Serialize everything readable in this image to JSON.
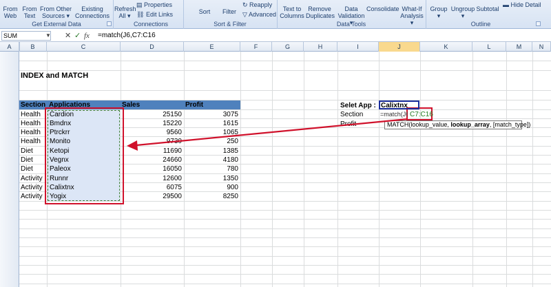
{
  "ribbon": {
    "buttons": [
      {
        "line1": "From",
        "line2": "Web"
      },
      {
        "line1": "From",
        "line2": "Text"
      },
      {
        "line1": "From Other",
        "line2": "Sources ▾"
      },
      {
        "line1": "Existing",
        "line2": "Connections"
      },
      {
        "line1": "Refresh",
        "line2": "All ▾"
      },
      {
        "line1": "Properties",
        "line2": ""
      },
      {
        "line1": "Edit Links",
        "line2": ""
      },
      {
        "line1": "Sort",
        "line2": ""
      },
      {
        "line1": "Filter",
        "line2": ""
      },
      {
        "line1": "Reapply",
        "line2": ""
      },
      {
        "line1": "Advanced",
        "line2": ""
      },
      {
        "line1": "Text to",
        "line2": "Columns"
      },
      {
        "line1": "Remove",
        "line2": "Duplicates"
      },
      {
        "line1": "Data",
        "line2": "Validation ▾"
      },
      {
        "line1": "Consolidate",
        "line2": ""
      },
      {
        "line1": "What-If",
        "line2": "Analysis ▾"
      },
      {
        "line1": "Group",
        "line2": "▾"
      },
      {
        "line1": "Ungroup",
        "line2": "▾"
      },
      {
        "line1": "Subtotal",
        "line2": ""
      },
      {
        "line1": "Hide Detail",
        "line2": ""
      }
    ],
    "groups": [
      "Get External Data",
      "Connections",
      "Sort & Filter",
      "Data Tools",
      "Outline"
    ]
  },
  "formula_bar": {
    "name_box": "SUM",
    "cancel_icon": "✕",
    "enter_icon": "✓",
    "fx_icon": "fx",
    "formula": "=match(J6,C7:C16"
  },
  "columns": [
    "A",
    "B",
    "C",
    "D",
    "E",
    "F",
    "G",
    "H",
    "I",
    "J",
    "K",
    "L",
    "M",
    "N"
  ],
  "sheet": {
    "title": "INDEX and MATCH",
    "headers": {
      "section": "Section",
      "applications": "Applications",
      "sales": "Sales",
      "profit": "Profit"
    },
    "rows": [
      {
        "section": "Health",
        "app": "Cardion",
        "sales": "25150",
        "profit": "3075"
      },
      {
        "section": "Health",
        "app": "Bmdnx",
        "sales": "15220",
        "profit": "1615"
      },
      {
        "section": "Health",
        "app": "Ptrckrr",
        "sales": "9560",
        "profit": "1065"
      },
      {
        "section": "Health",
        "app": "Monito",
        "sales": "9730",
        "profit": "250"
      },
      {
        "section": "Diet",
        "app": "Ketopi",
        "sales": "11690",
        "profit": "1385"
      },
      {
        "section": "Diet",
        "app": "Vegnx",
        "sales": "24660",
        "profit": "4180"
      },
      {
        "section": "Diet",
        "app": "Paleox",
        "sales": "16050",
        "profit": "780"
      },
      {
        "section": "Activity",
        "app": "Runnr",
        "sales": "12600",
        "profit": "1350"
      },
      {
        "section": "Activity",
        "app": "Calixtnx",
        "sales": "6075",
        "profit": "900"
      },
      {
        "section": "Activity",
        "app": "Yogix",
        "sales": "29500",
        "profit": "8250"
      }
    ],
    "lookup": {
      "select_label": "Selet App :",
      "select_value": "Calixtnx",
      "section_label": "Section",
      "profit_label": "Profit",
      "section_formula_prefix": "=match(J6,",
      "section_formula_range": "C7:C16"
    },
    "tooltip": {
      "prefix": "MATCH(lookup_value, ",
      "bold": "lookup_array",
      "suffix": ", [match_type])"
    }
  },
  "colors": {
    "header_band": "#4f81bd",
    "highlight_red": "#d0112b",
    "selection_fill": "#dce6f6"
  }
}
